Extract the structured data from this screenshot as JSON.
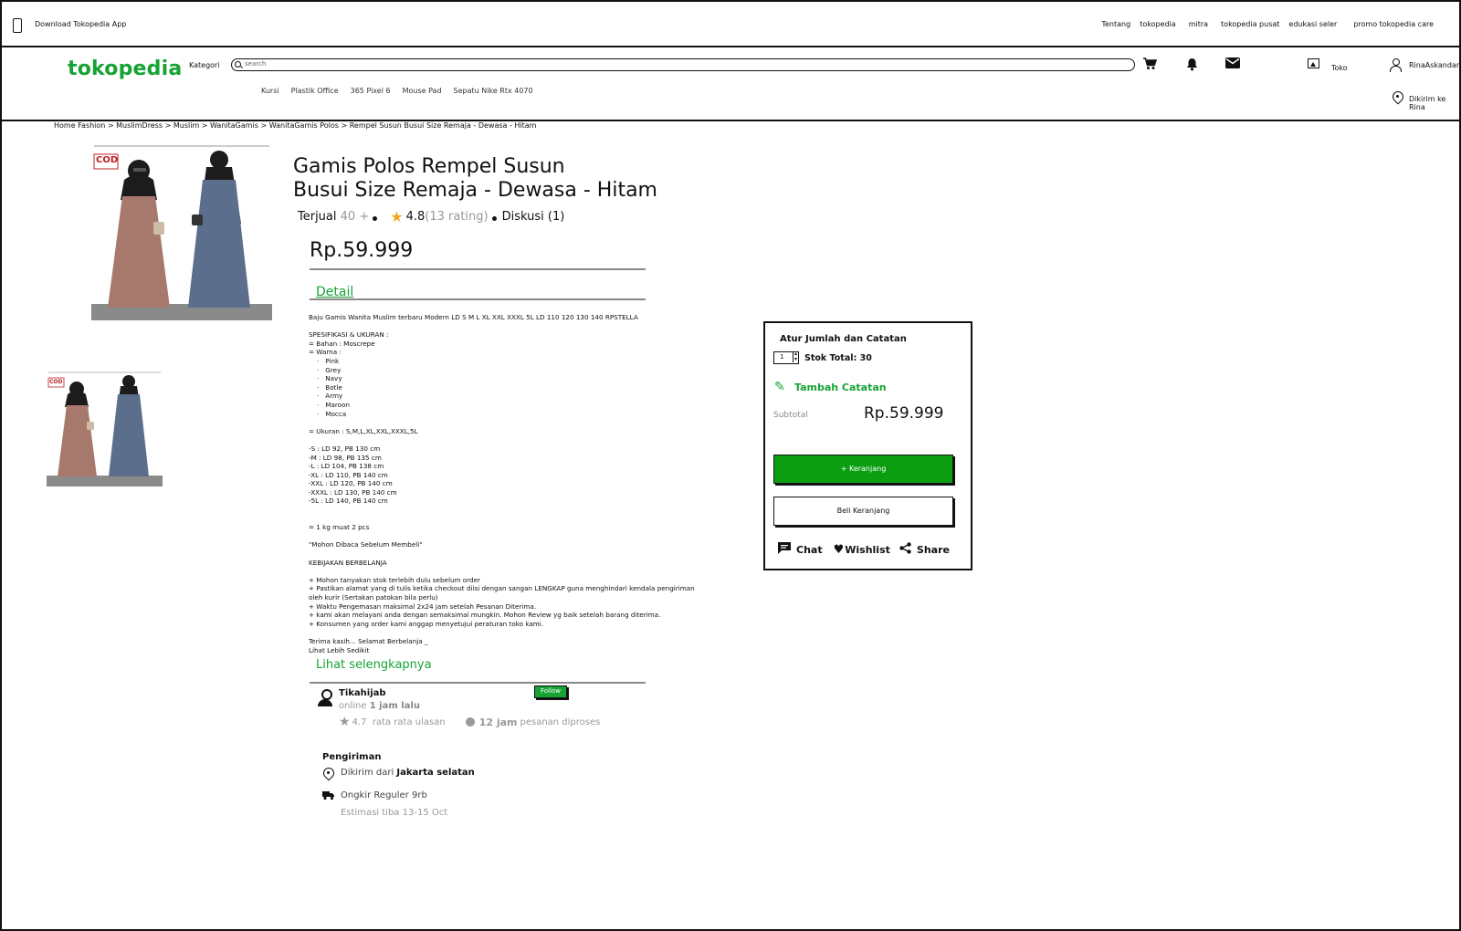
{
  "topbar": {
    "download_app": "Download Tokopedia App",
    "links": [
      "Tentang",
      "tokopedia",
      "mitra",
      "tokopedia pusat",
      "edukasi seler",
      "promo tokopedia care"
    ]
  },
  "header": {
    "logo": "tokopedia",
    "kategori": "Kategori",
    "search_placeholder": "search",
    "toko": "Toko",
    "user": "RinaAskandar",
    "dikirim_ke": "Dikirim ke",
    "dikirim_nama": "Rina",
    "quick_links": [
      "Kursi",
      "Plastik Office",
      "365 Pixel 6",
      "Mouse Pad",
      "Sepatu Nike Rtx 4070"
    ]
  },
  "breadcrumb": "Home  Fashion    > MuslimDress  > Muslim > WanitaGamis   >  WanitaGamis Polos > Rempel Susun Busui Size Remaja - Dewasa - Hitam",
  "product": {
    "title_line1": "Gamis Polos Rempel Susun",
    "title_line2": "Busui Size Remaja - Dewasa - Hitam",
    "terjual_label": "Terjual",
    "terjual_value": "40 +",
    "rating": "4.8",
    "rating_count": "(13 rating)",
    "diskusi": "Diskusi (1)",
    "price": "Rp.59.999",
    "badge": "COD"
  },
  "detail": {
    "tab_label": "Detail",
    "description": "Baju Gamis Wanita Muslim terbaru Modern LD S M L XL XXL XXXL 5L LD 110 120 130 140 RPSTELLA\n\nSPESIFIKASI & UKURAN :\n= Bahan : Moscrepe\n= Warna :\n    ·   Pink\n    ·   Grey\n    ·   Navy\n    ·   Botle\n    ·   Army\n    ·   Maroon\n    ·   Mocca\n\n= Ukuran : S,M,L,XL,XXL,XXXL,5L\n\n-S : LD 92, PB 130 cm\n-M : LD 98, PB 135 cm\n-L : LD 104, PB 138 cm\n-XL : LD 110, PB 140 cm\n-XXL : LD 120, PB 140 cm\n-XXXL : LD 130, PB 140 cm\n-5L : LD 140, PB 140 cm\n\n\n= 1 kg muat 2 pcs\n\n\"Mohon Dibaca Sebelum Membeli\"\n\nKEBIJAKAN BERBELANJA\n\n+ Mohon tanyakan stok terlebih dulu sebelum order\n+ Pastikan alamat yang di tulis ketika checkout diisi dengan sangan LENGKAP guna menghindari kendala pengiriman\noleh kurir (Sertakan patokan bila perlu)\n+ Waktu Pengemasan maksimal 2x24 jam setelah Pesanan Diterima.\n+ kami akan melayani anda dengan semaksimal mungkin. Mohon Review yg baik setelah barang diterima.\n+ Konsumen yang order kami anggap menyetujui peraturan toko kami.\n\nTerima kasih... Selamat Berbelanja _\nLihat Lebih Sedikit",
    "see_more": "Lihat selengkapnya"
  },
  "seller": {
    "name": "Tikahijab",
    "follow": "Follow",
    "online_label": "online",
    "online_time": "1 jam lalu",
    "rating": "4.7",
    "rating_label": "rata rata ulasan",
    "process_time": "12 jam",
    "process_label": "pesanan diproses"
  },
  "shipping": {
    "title": "Pengiriman",
    "from_label": "Dikirim dari",
    "from_city": "Jakarta selatan",
    "ongkir": "Ongkir Reguler 9rb",
    "estimasi": "Estimasi tiba 13-15 Oct"
  },
  "purchase_box": {
    "title": "Atur Jumlah dan Catatan",
    "qty": "1",
    "stok": "Stok Total: 30",
    "tambah_catatan": "Tambah Catatan",
    "subtotal_label": "Subtotal",
    "subtotal_value": "Rp.59.999",
    "add_cart": "+ Keranjang",
    "buy": "Beli Keranjang",
    "chat": "Chat",
    "wishlist": "Wishlist",
    "share": "Share"
  },
  "colors": {
    "brand_green": "#16a334",
    "button_green": "#0b9e10",
    "star": "#f5a623"
  }
}
